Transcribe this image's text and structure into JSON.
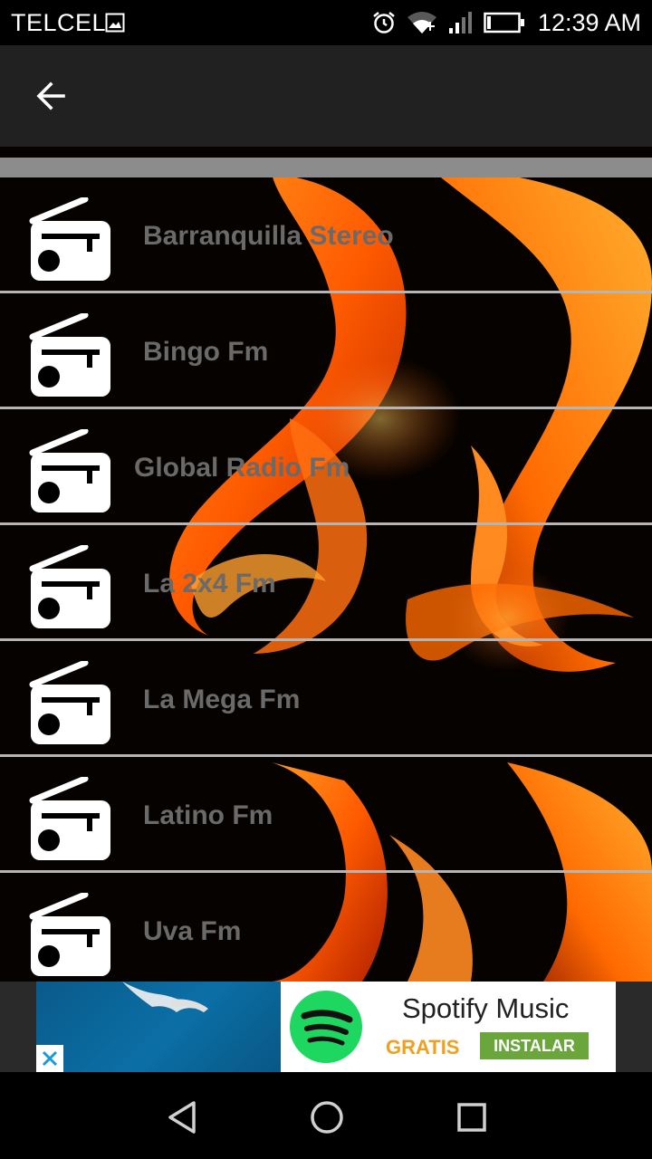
{
  "status_bar": {
    "carrier": "TELCEL",
    "time": "12:39 AM",
    "icons": [
      "image-icon",
      "alarm-icon",
      "wifi-icon",
      "signal-icon",
      "battery-icon"
    ]
  },
  "app_bar": {
    "back_icon": "arrow-left-icon"
  },
  "stations": [
    {
      "name": "Barranquilla Stereo"
    },
    {
      "name": "Bingo Fm"
    },
    {
      "name": "Global Radio Fm"
    },
    {
      "name": "La 2x4 Fm"
    },
    {
      "name": "La Mega Fm"
    },
    {
      "name": "Latino Fm"
    },
    {
      "name": "Uva Fm"
    }
  ],
  "ad": {
    "title": "Spotify Music",
    "tag": "GRATIS",
    "cta": "INSTALAR",
    "close_icon": "close-icon",
    "colors": {
      "spotify_green": "#1ed760",
      "cta_bg": "#6aa63c",
      "tag": "#f0a020"
    }
  },
  "nav": {
    "icons": [
      "back-triangle-icon",
      "home-circle-icon",
      "recents-square-icon"
    ]
  },
  "colors": {
    "app_bar_bg": "#212121",
    "station_text": "#6a6a6a",
    "divider": "#b5b5b5"
  }
}
